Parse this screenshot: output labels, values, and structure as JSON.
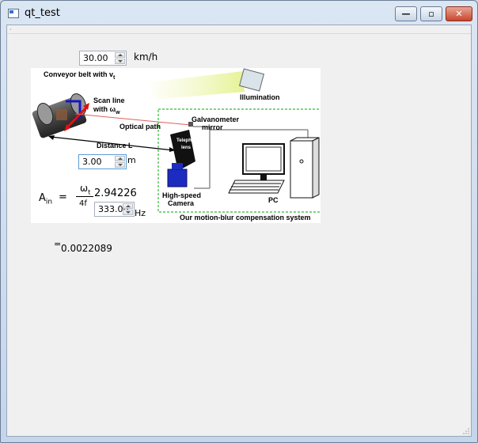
{
  "window": {
    "title": "qt_test",
    "minimize_label": "—",
    "maximize_label": "▫",
    "close_label": "✕"
  },
  "speed": {
    "value": "30.00",
    "unit": "km/h"
  },
  "diagram": {
    "conveyor_label": "Conveyor belt with v",
    "conveyor_sub": "t",
    "scan_line_label": "Scan line",
    "scan_line_with": "with ω",
    "scan_line_sub": "w",
    "illumination_label": "Illumination",
    "galvanometer_label": "Galvanometer",
    "mirror_label": "mirror",
    "optical_path_label": "Optical path",
    "distance_label": "Distance L",
    "telephoto_label": "Telephoto",
    "lens_label": "lens",
    "camera_label_1": "High-speed",
    "camera_label_2": "Camera",
    "pc_label": "PC",
    "system_label": "Our motion-blur compensation system"
  },
  "distance": {
    "value": "3.00",
    "unit": "m"
  },
  "formula": {
    "lhs": "A",
    "lhs_sub": "in",
    "equals": "=",
    "numerator": "ω",
    "numerator_sub": "t",
    "denominator": "4f",
    "omega_value": "2.94226",
    "frequency_value": "333.00",
    "frequency_unit": "Hz"
  },
  "result": {
    "equals": "=",
    "value": "0.0022089"
  }
}
